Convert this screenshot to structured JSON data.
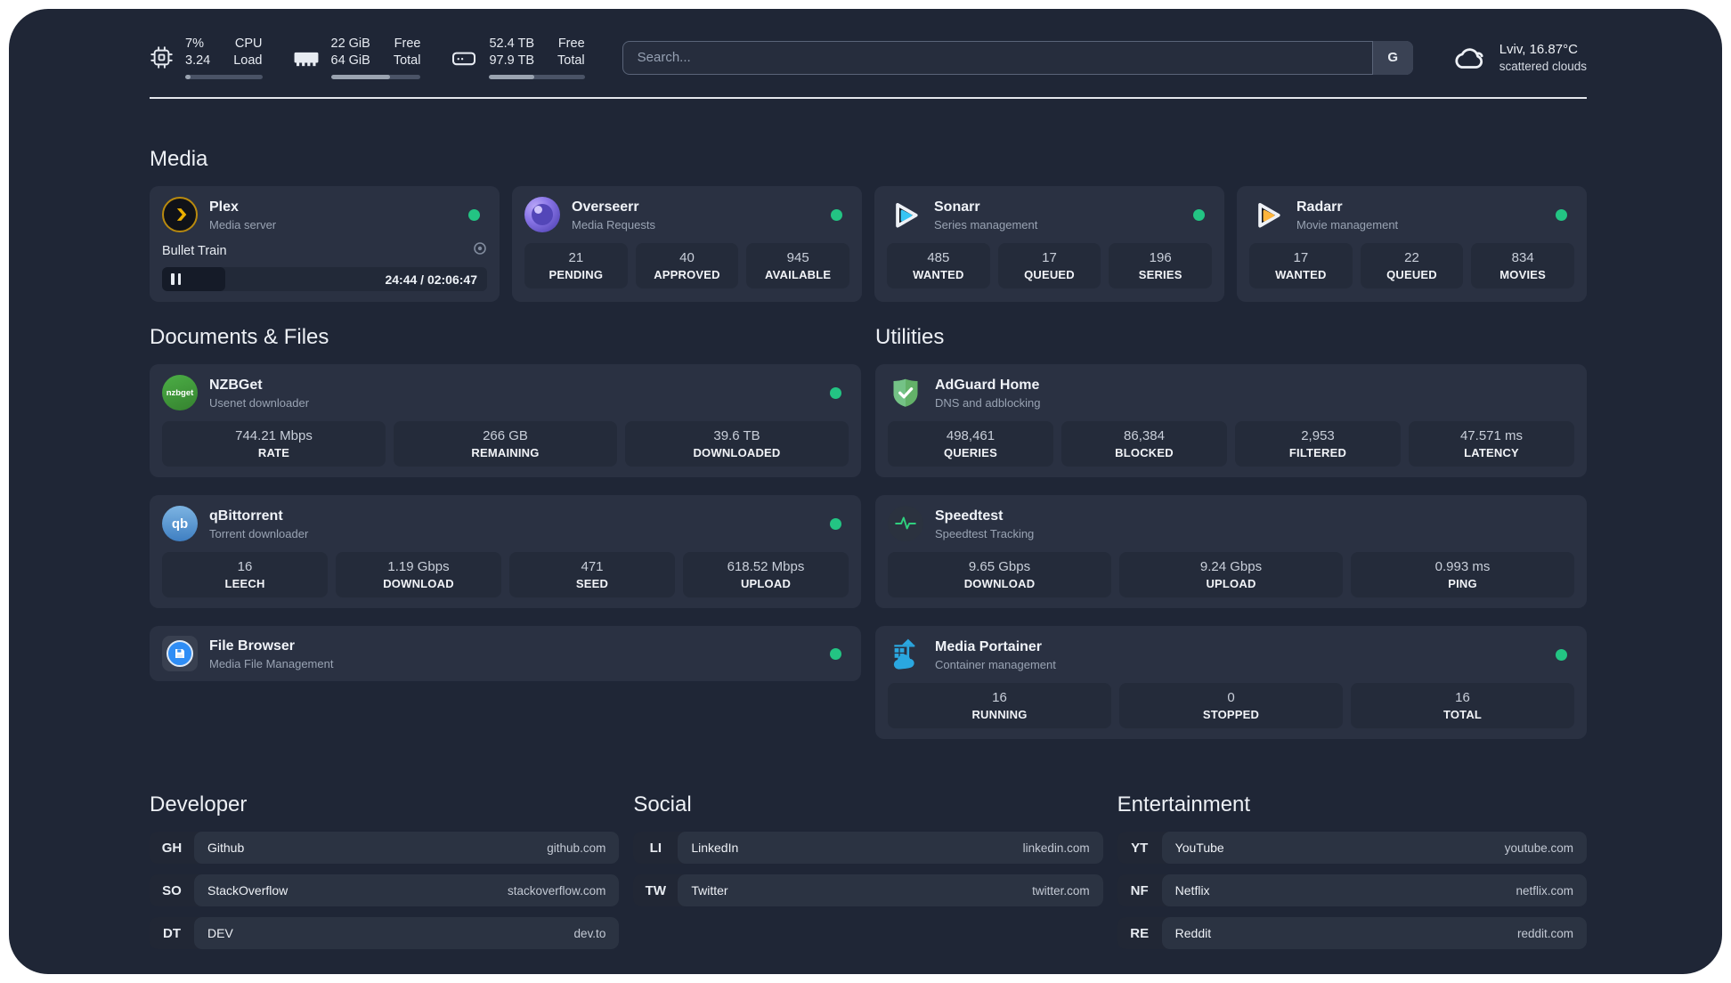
{
  "header": {
    "cpu": {
      "value_primary": "7%",
      "value_secondary": "3.24",
      "label_primary": "CPU",
      "label_secondary": "Load",
      "usage_percent": 7
    },
    "memory": {
      "value_primary": "22 GiB",
      "value_secondary": "64 GiB",
      "label_primary": "Free",
      "label_secondary": "Total",
      "usage_percent": 66
    },
    "disk": {
      "value_primary": "52.4 TB",
      "value_secondary": "97.9 TB",
      "label_primary": "Free",
      "label_secondary": "Total",
      "usage_percent": 47
    },
    "search": {
      "placeholder": "Search...",
      "engine_button": "G"
    },
    "weather": {
      "location_temperature": "Lviv, 16.87°C",
      "condition": "scattered clouds"
    }
  },
  "colors": {
    "status_online": "#23c483"
  },
  "media": {
    "title": "Media",
    "cards": [
      {
        "name": "Plex",
        "description": "Media server",
        "status": "online",
        "player": {
          "title": "Bullet Train",
          "time": "24:44 / 02:06:47",
          "progress_percent": 19.5
        }
      },
      {
        "name": "Overseerr",
        "description": "Media Requests",
        "status": "online",
        "stats": [
          {
            "value": "21",
            "label": "PENDING"
          },
          {
            "value": "40",
            "label": "APPROVED"
          },
          {
            "value": "945",
            "label": "AVAILABLE"
          }
        ]
      },
      {
        "name": "Sonarr",
        "description": "Series management",
        "status": "online",
        "stats": [
          {
            "value": "485",
            "label": "WANTED"
          },
          {
            "value": "17",
            "label": "QUEUED"
          },
          {
            "value": "196",
            "label": "SERIES"
          }
        ]
      },
      {
        "name": "Radarr",
        "description": "Movie management",
        "status": "online",
        "stats": [
          {
            "value": "17",
            "label": "WANTED"
          },
          {
            "value": "22",
            "label": "QUEUED"
          },
          {
            "value": "834",
            "label": "MOVIES"
          }
        ]
      }
    ]
  },
  "documents": {
    "title": "Documents & Files",
    "cards": [
      {
        "name": "NZBGet",
        "description": "Usenet downloader",
        "status": "online",
        "icon_text": "nzbget",
        "stats": [
          {
            "value": "744.21 Mbps",
            "label": "RATE"
          },
          {
            "value": "266 GB",
            "label": "REMAINING"
          },
          {
            "value": "39.6 TB",
            "label": "DOWNLOADED"
          }
        ]
      },
      {
        "name": "qBittorrent",
        "description": "Torrent downloader",
        "status": "online",
        "icon_text": "qb",
        "stats": [
          {
            "value": "16",
            "label": "LEECH"
          },
          {
            "value": "1.19 Gbps",
            "label": "DOWNLOAD"
          },
          {
            "value": "471",
            "label": "SEED"
          },
          {
            "value": "618.52 Mbps",
            "label": "UPLOAD"
          }
        ]
      },
      {
        "name": "File Browser",
        "description": "Media File Management",
        "status": "online"
      }
    ]
  },
  "utilities": {
    "title": "Utilities",
    "cards": [
      {
        "name": "AdGuard Home",
        "description": "DNS and adblocking",
        "stats": [
          {
            "value": "498,461",
            "label": "QUERIES"
          },
          {
            "value": "86,384",
            "label": "BLOCKED"
          },
          {
            "value": "2,953",
            "label": "FILTERED"
          },
          {
            "value": "47.571 ms",
            "label": "LATENCY"
          }
        ]
      },
      {
        "name": "Speedtest",
        "description": "Speedtest Tracking",
        "stats": [
          {
            "value": "9.65 Gbps",
            "label": "DOWNLOAD"
          },
          {
            "value": "9.24 Gbps",
            "label": "UPLOAD"
          },
          {
            "value": "0.993 ms",
            "label": "PING"
          }
        ]
      },
      {
        "name": "Media Portainer",
        "description": "Container management",
        "status": "online",
        "stats": [
          {
            "value": "16",
            "label": "RUNNING"
          },
          {
            "value": "0",
            "label": "STOPPED"
          },
          {
            "value": "16",
            "label": "TOTAL"
          }
        ]
      }
    ]
  },
  "bookmarks": [
    {
      "title": "Developer",
      "links": [
        {
          "abbr": "GH",
          "name": "Github",
          "url": "github.com"
        },
        {
          "abbr": "SO",
          "name": "StackOverflow",
          "url": "stackoverflow.com"
        },
        {
          "abbr": "DT",
          "name": "DEV",
          "url": "dev.to"
        }
      ]
    },
    {
      "title": "Social",
      "links": [
        {
          "abbr": "LI",
          "name": "LinkedIn",
          "url": "linkedin.com"
        },
        {
          "abbr": "TW",
          "name": "Twitter",
          "url": "twitter.com"
        }
      ]
    },
    {
      "title": "Entertainment",
      "links": [
        {
          "abbr": "YT",
          "name": "YouTube",
          "url": "youtube.com"
        },
        {
          "abbr": "NF",
          "name": "Netflix",
          "url": "netflix.com"
        },
        {
          "abbr": "RE",
          "name": "Reddit",
          "url": "reddit.com"
        }
      ]
    }
  ]
}
